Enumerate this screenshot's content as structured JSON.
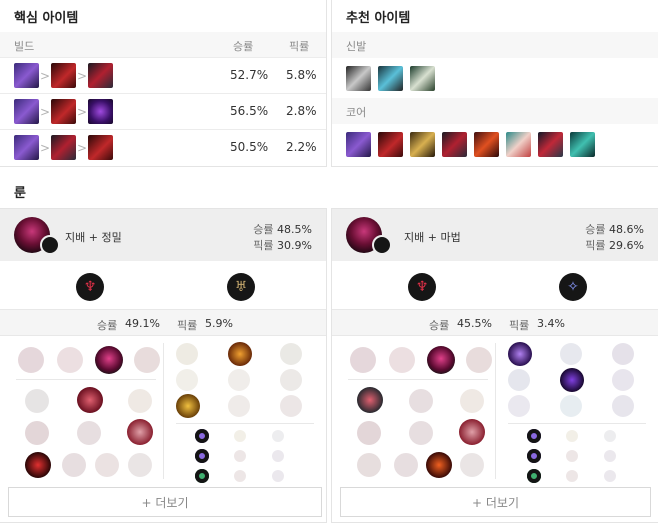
{
  "core": {
    "title": "핵심 아이템",
    "col_build": "빌드",
    "col_win": "승률",
    "col_pick": "픽률",
    "rows": [
      {
        "win": "52.7%",
        "pick": "5.8%"
      },
      {
        "win": "56.5%",
        "pick": "2.8%"
      },
      {
        "win": "50.5%",
        "pick": "2.2%"
      }
    ],
    "arrow": ">"
  },
  "recommended": {
    "title": "추천 아이템",
    "boots_label": "신발",
    "core_label": "코어"
  },
  "runes": {
    "title": "룬",
    "pages": [
      {
        "name": "지배 + 정밀",
        "win_label": "승률",
        "win": "48.5%",
        "pick_label": "픽률",
        "pick": "30.9%",
        "bar_win_label": "승률",
        "bar_win": "49.1%",
        "bar_pick_label": "픽률",
        "bar_pick": "5.9%",
        "more": "+ 더보기"
      },
      {
        "name": "지배 + 마법",
        "win_label": "승률",
        "win": "48.6%",
        "pick_label": "픽률",
        "pick": "29.6%",
        "bar_win_label": "승률",
        "bar_win": "45.5%",
        "bar_pick_label": "픽률",
        "bar_pick": "3.4%",
        "more": "+ 더보기"
      }
    ]
  },
  "colors": {
    "domination": "#c8387a",
    "precision": "#c8aa6e",
    "sorcery": "#6b7bff",
    "border": "#e4e4e4"
  }
}
